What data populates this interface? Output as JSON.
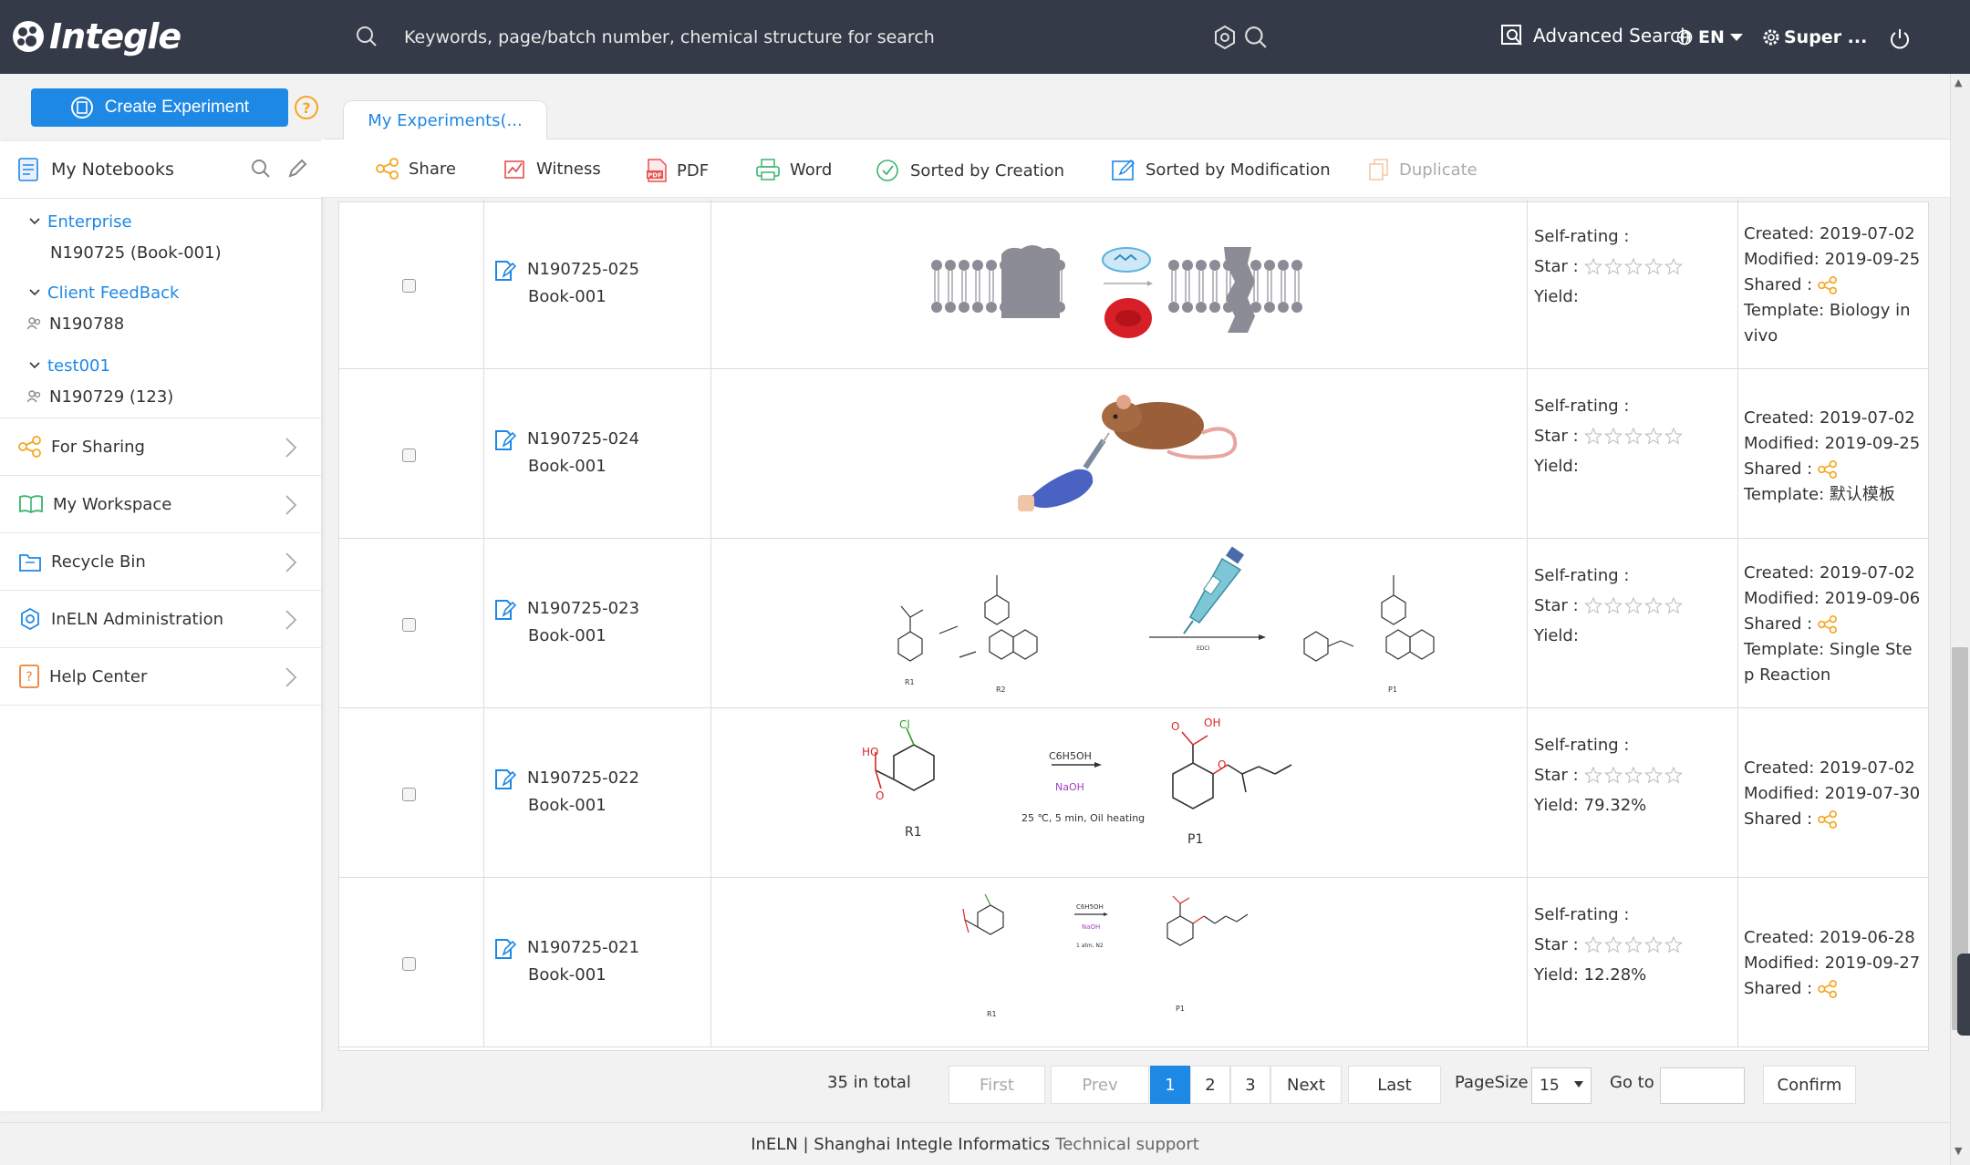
{
  "header": {
    "logo_text": "Integle",
    "search_placeholder": "Keywords, page/batch number, chemical structure for search",
    "advanced_search": "Advanced Search",
    "language": "EN",
    "user": "Super ..."
  },
  "create_button": "Create Experiment",
  "help_symbol": "?",
  "tab": {
    "label": "My Experiments(..."
  },
  "toolbar": {
    "share": "Share",
    "witness": "Witness",
    "pdf": "PDF",
    "word": "Word",
    "sorted_creation": "Sorted by Creation",
    "sorted_modification": "Sorted by Modification",
    "duplicate": "Duplicate"
  },
  "sidebar": {
    "notebooks_label": "My Notebooks",
    "groups": [
      {
        "name": "Enterprise",
        "item": "N190725 (Book-001)"
      },
      {
        "name": "Client FeedBack",
        "item": "N190788"
      },
      {
        "name": "test001",
        "item": "N190729 (123)"
      }
    ],
    "menu": [
      {
        "label": "For Sharing",
        "icon": "share-icon"
      },
      {
        "label": "My Workspace",
        "icon": "book-icon"
      },
      {
        "label": "Recycle Bin",
        "icon": "bin-icon"
      },
      {
        "label": "InELN Administration",
        "icon": "gear-icon"
      },
      {
        "label": "Help Center",
        "icon": "help-icon"
      }
    ]
  },
  "labels": {
    "self_rating": "Self-rating :",
    "star": "Star :",
    "yield": "Yield:",
    "created": "Created:",
    "modified": "Modified:",
    "shared": "Shared :",
    "template": "Template:"
  },
  "experiments": [
    {
      "id": "N190725-025",
      "book": "Book-001",
      "yield": "",
      "created": "2019-07-02",
      "modified": "2019-09-25",
      "template": "Biology in vivo",
      "template_line1": "Template: Biology in",
      "template_line2": "vivo",
      "scheme": "biology-membrane"
    },
    {
      "id": "N190725-024",
      "book": "Book-001",
      "yield": "",
      "created": "2019-07-02",
      "modified": "2019-09-25",
      "template": "默认模板",
      "template_line1": "Template: 默认模板",
      "template_line2": "",
      "scheme": "mouse-injection"
    },
    {
      "id": "N190725-023",
      "book": "Book-001",
      "yield": "",
      "created": "2019-07-02",
      "modified": "2019-09-06",
      "template": "Single Step Reaction",
      "template_line1": "Template: Single Ste",
      "template_line2": "p Reaction",
      "scheme": "reaction-pipette"
    },
    {
      "id": "N190725-022",
      "book": "Book-001",
      "yield": "79.32%",
      "created": "2019-07-02",
      "modified": "2019-07-30",
      "template": "",
      "template_line1": "",
      "template_line2": "",
      "scheme": "reaction-large"
    },
    {
      "id": "N190725-021",
      "book": "Book-001",
      "yield": "12.28%",
      "created": "2019-06-28",
      "modified": "2019-09-27",
      "template": "",
      "template_line1": "",
      "template_line2": "",
      "scheme": "reaction-small"
    }
  ],
  "scheme_text": {
    "r023_r1": "R1",
    "r023_r2": "R2",
    "r023_p1": "P1",
    "r023_reagent": "EDCI",
    "r022_r1": "R1",
    "r022_p1": "P1",
    "r022_reagent1": "C6H5OH",
    "r022_reagent2": "NaOH",
    "r022_cond": "25 ℃, 5 min, Oil heating",
    "r022_ho": "HO",
    "r022_o": "O",
    "r022_cl": "Cl",
    "r022_oh": "OH",
    "r021_r1": "R1",
    "r021_p1": "P1",
    "r021_reagent1": "C6H5OH",
    "r021_reagent2": "NaOH",
    "r021_cond": "1 atm, N2"
  },
  "pagination": {
    "total": "35 in total",
    "first": "First",
    "prev": "Prev",
    "pages": [
      "1",
      "2",
      "3"
    ],
    "current": "1",
    "next": "Next",
    "last": "Last",
    "pagesize_label": "PageSize",
    "pagesize": "15",
    "goto_label": "Go to",
    "confirm": "Confirm"
  },
  "footer": {
    "text": "InELN | Shanghai Integle Informatics",
    "support": "Technical support"
  },
  "colors": {
    "header_bg": "#343a47",
    "accent": "#1e88e5",
    "share_icon": "#f5a623"
  }
}
